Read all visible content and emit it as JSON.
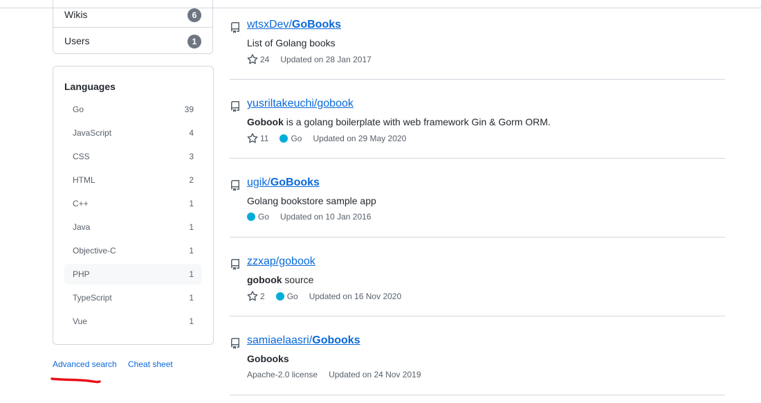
{
  "types": [
    {
      "label": "Wikis",
      "count": "6"
    },
    {
      "label": "Users",
      "count": "1"
    }
  ],
  "languages": {
    "title": "Languages",
    "items": [
      {
        "name": "Go",
        "count": "39"
      },
      {
        "name": "JavaScript",
        "count": "4"
      },
      {
        "name": "CSS",
        "count": "3"
      },
      {
        "name": "HTML",
        "count": "2"
      },
      {
        "name": "C++",
        "count": "1"
      },
      {
        "name": "Java",
        "count": "1"
      },
      {
        "name": "Objective-C",
        "count": "1"
      },
      {
        "name": "PHP",
        "count": "1",
        "selected": true
      },
      {
        "name": "TypeScript",
        "count": "1"
      },
      {
        "name": "Vue",
        "count": "1"
      }
    ]
  },
  "footer": {
    "advanced_search": "Advanced search",
    "cheat_sheet": "Cheat sheet"
  },
  "results": [
    {
      "owner": "wtsxDev/",
      "name": "GoBooks",
      "name_bold": true,
      "desc_bold": "",
      "desc": "List of Golang books",
      "stars": "24",
      "language": "",
      "license": "",
      "updated": "Updated on 28 Jan 2017"
    },
    {
      "owner": "yusriltakeuchi/gobook",
      "name": "",
      "name_bold": false,
      "desc_bold": "Gobook",
      "desc": " is a golang boilerplate with web framework Gin & Gorm ORM.",
      "stars": "11",
      "language": "Go",
      "license": "",
      "updated": "Updated on 29 May 2020"
    },
    {
      "owner": "ugik/",
      "name": "GoBooks",
      "name_bold": true,
      "desc_bold": "",
      "desc": "Golang bookstore sample app",
      "stars": "",
      "language": "Go",
      "license": "",
      "updated": "Updated on 10 Jan 2016"
    },
    {
      "owner": "zzxap/gobook",
      "name": "",
      "name_bold": false,
      "desc_bold": "gobook",
      "desc": " source",
      "stars": "2",
      "language": "Go",
      "license": "",
      "updated": "Updated on 16 Nov 2020"
    },
    {
      "owner": "samiaelaasri/",
      "name": "Gobooks",
      "name_bold": true,
      "desc_bold": "Gobooks",
      "desc": "",
      "stars": "",
      "language": "",
      "license": "Apache-2.0 license",
      "updated": "Updated on 24 Nov 2019"
    }
  ],
  "colors": {
    "link": "#0969da",
    "go_language": "#00add8",
    "annotation": "#e8101a"
  }
}
